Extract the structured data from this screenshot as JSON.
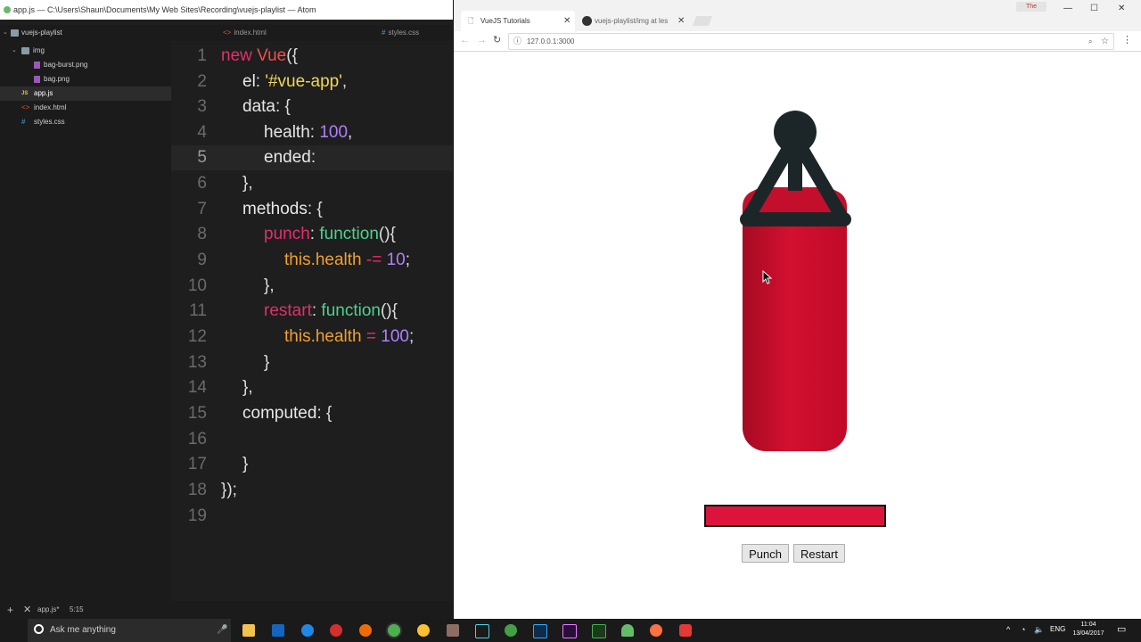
{
  "atom": {
    "title": "app.js — C:\\Users\\Shaun\\Documents\\My Web Sites\\Recording\\vuejs-playlist — Atom",
    "tree": {
      "root": "vuejs-playlist",
      "img_folder": "img",
      "files": [
        "bag-burst.png",
        "bag.png",
        "app.js",
        "index.html",
        "styles.css"
      ]
    },
    "tabs": [
      "index.html",
      "styles.css"
    ],
    "line_numbers": [
      "1",
      "2",
      "3",
      "4",
      "5",
      "6",
      "7",
      "8",
      "9",
      "10",
      "11",
      "12",
      "13",
      "14",
      "15",
      "16",
      "17",
      "18",
      "19"
    ],
    "code": {
      "l1_new": "new",
      "l1_vue": " Vue",
      "l1_p": "({",
      "l2_key": "el",
      "l2_colon": ": ",
      "l2_str": "'#vue-app'",
      "l2_comma": ",",
      "l3_key": "data",
      "l3_rest": ": {",
      "l4_key": "health",
      "l4_colon": ": ",
      "l4_num": "100",
      "l4_comma": ",",
      "l5_key": "ended",
      "l5_colon": ":",
      "l6": "},",
      "l7_key": "methods",
      "l7_rest": ": {",
      "l8_key": "punch",
      "l8_colon": ": ",
      "l8_fn": "function",
      "l8_rest": "(){",
      "l9_this": "this.health",
      "l9_op": " -= ",
      "l9_num": "10",
      "l9_end": ";",
      "l10": "},",
      "l11_key": "restart",
      "l11_colon": ": ",
      "l11_fn": "function",
      "l11_rest": "(){",
      "l12_this": "this.health",
      "l12_op": " = ",
      "l12_num": "100",
      "l12_end": ";",
      "l13": "}",
      "l14": "},",
      "l15_key": "computed",
      "l15_rest": ": {",
      "l17": "}",
      "l18": "});"
    },
    "status": {
      "file": "app.js*",
      "cursor": "5:15"
    }
  },
  "chrome": {
    "tabs": [
      "VueJS Tutorials",
      "vuejs-playlist/img at les"
    ],
    "url": "127.0.0.1:3000",
    "profile": "The"
  },
  "app": {
    "health": 100,
    "punch_label": "Punch",
    "restart_label": "Restart",
    "bag_color": "#c8102e",
    "health_color": "#dc143c"
  },
  "taskbar": {
    "search_placeholder": "Ask me anything",
    "language": "ENG",
    "time": "11:04",
    "date": "13/04/2017"
  }
}
